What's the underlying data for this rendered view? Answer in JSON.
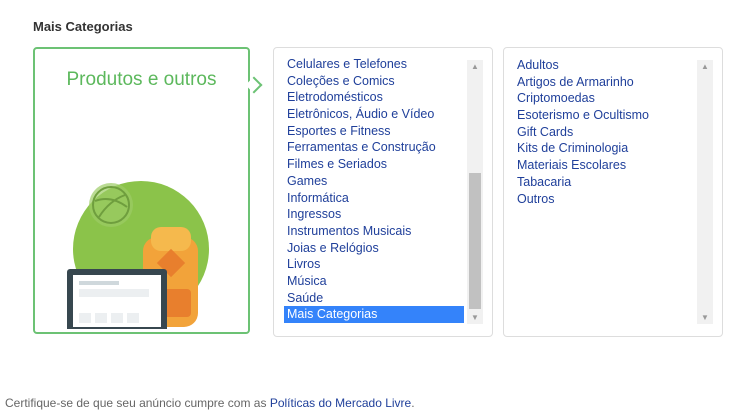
{
  "section": {
    "title": "Mais Categorias"
  },
  "card": {
    "title": "Produtos e outros"
  },
  "categories": {
    "items": [
      "Celulares e Telefones",
      "Coleções e Comics",
      "Eletrodomésticos",
      "Eletrônicos, Áudio e Vídeo",
      "Esportes e Fitness",
      "Ferramentas e Construção",
      "Filmes e Seriados",
      "Games",
      "Informática",
      "Ingressos",
      "Instrumentos Musicais",
      "Joias e Relógios",
      "Livros",
      "Música",
      "Saúde",
      "Mais Categorias"
    ],
    "selected": "Mais Categorias"
  },
  "subcategories": {
    "items": [
      "Adultos",
      "Artigos de Armarinho",
      "Criptomoedas",
      "Esoterismo e Ocultismo",
      "Gift Cards",
      "Kits de Criminologia",
      "Materiais Escolares",
      "Tabacaria",
      "Outros"
    ]
  },
  "footer": {
    "text": "Certifique-se de que seu anúncio cumpre com as ",
    "link": "Políticas do Mercado Livre",
    "end": "."
  },
  "icons": {
    "scroll_up": "triangle-up-icon",
    "scroll_down": "triangle-down-icon"
  },
  "colors": {
    "accent_green": "#6cc274",
    "link_blue": "#1f3f9a",
    "selected_blue": "#3483fa"
  }
}
